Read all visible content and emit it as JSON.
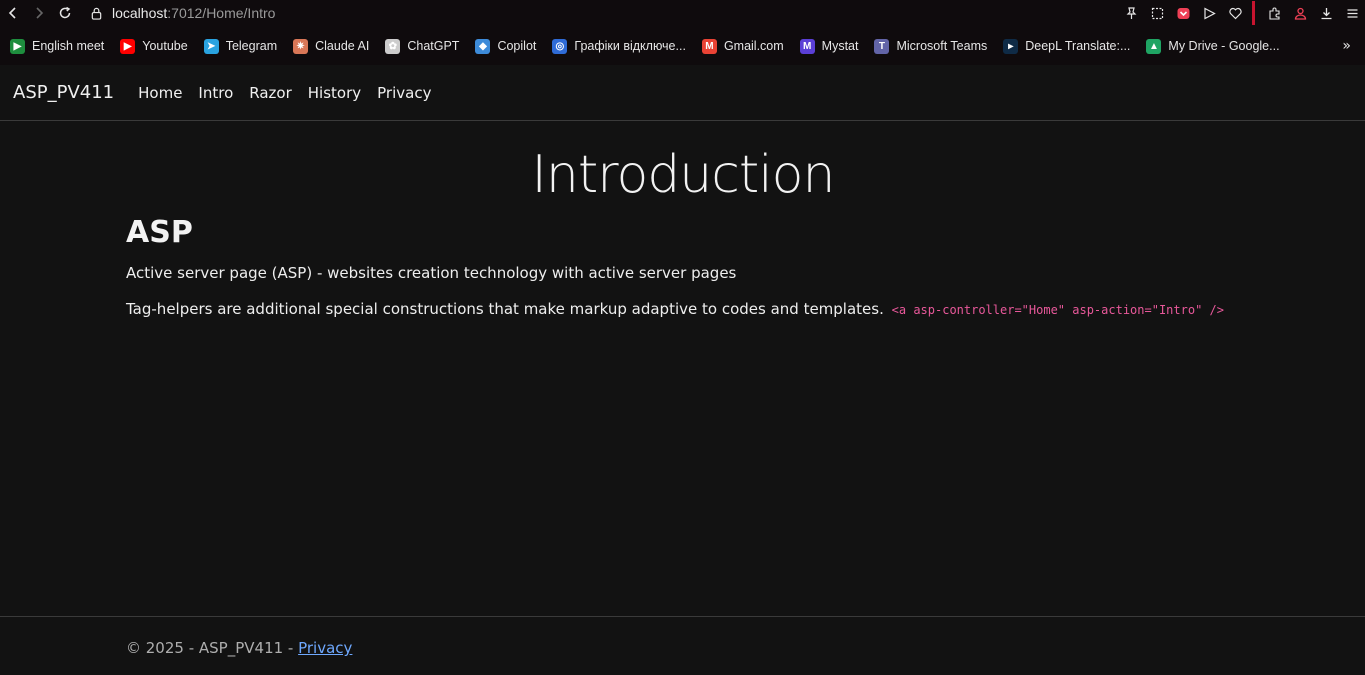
{
  "browser": {
    "url_host": "localhost",
    "url_path": ":7012/Home/Intro",
    "bookmarks": [
      {
        "label": "English meet",
        "icon": "meet-icon",
        "color": "#1e8e3e"
      },
      {
        "label": "Youtube",
        "icon": "youtube-icon",
        "color": "#ff0000"
      },
      {
        "label": "Telegram",
        "icon": "telegram-icon",
        "color": "#2aa3e0"
      },
      {
        "label": "Claude AI",
        "icon": "claude-icon",
        "color": "#d97757"
      },
      {
        "label": "ChatGPT",
        "icon": "chatgpt-icon",
        "color": "#cccccc"
      },
      {
        "label": "Copilot",
        "icon": "copilot-icon",
        "color": "#3d8bd9"
      },
      {
        "label": "Графіки відключе...",
        "icon": "schedule-icon",
        "color": "#2f6bd6"
      },
      {
        "label": "Gmail.com",
        "icon": "gmail-icon",
        "color": "#ea4335"
      },
      {
        "label": "Mystat",
        "icon": "mystat-icon",
        "color": "#5b3fd6"
      },
      {
        "label": "Microsoft Teams",
        "icon": "teams-icon",
        "color": "#6264a7"
      },
      {
        "label": "DeepL Translate:...",
        "icon": "deepl-icon",
        "color": "#0f2b46"
      },
      {
        "label": "My Drive - Google...",
        "icon": "drive-icon",
        "color": "#1fa463"
      }
    ]
  },
  "navbar": {
    "brand": "ASP_PV411",
    "links": [
      "Home",
      "Intro",
      "Razor",
      "History",
      "Privacy"
    ]
  },
  "main": {
    "title": "Introduction",
    "heading": "ASP",
    "paragraph1": "Active server page (ASP) - websites creation technology with active server pages",
    "paragraph2": "Tag-helpers are additional special constructions that make markup adaptive to codes and templates.",
    "code": "<a asp-controller=\"Home\" asp-action=\"Intro\" />"
  },
  "footer": {
    "text": "© 2025 - ASP_PV411 - ",
    "link": "Privacy"
  },
  "colors": {
    "background": "#121212",
    "code": "#e8589a",
    "link": "#6ea8fe",
    "accent_red": "#c8142f"
  }
}
